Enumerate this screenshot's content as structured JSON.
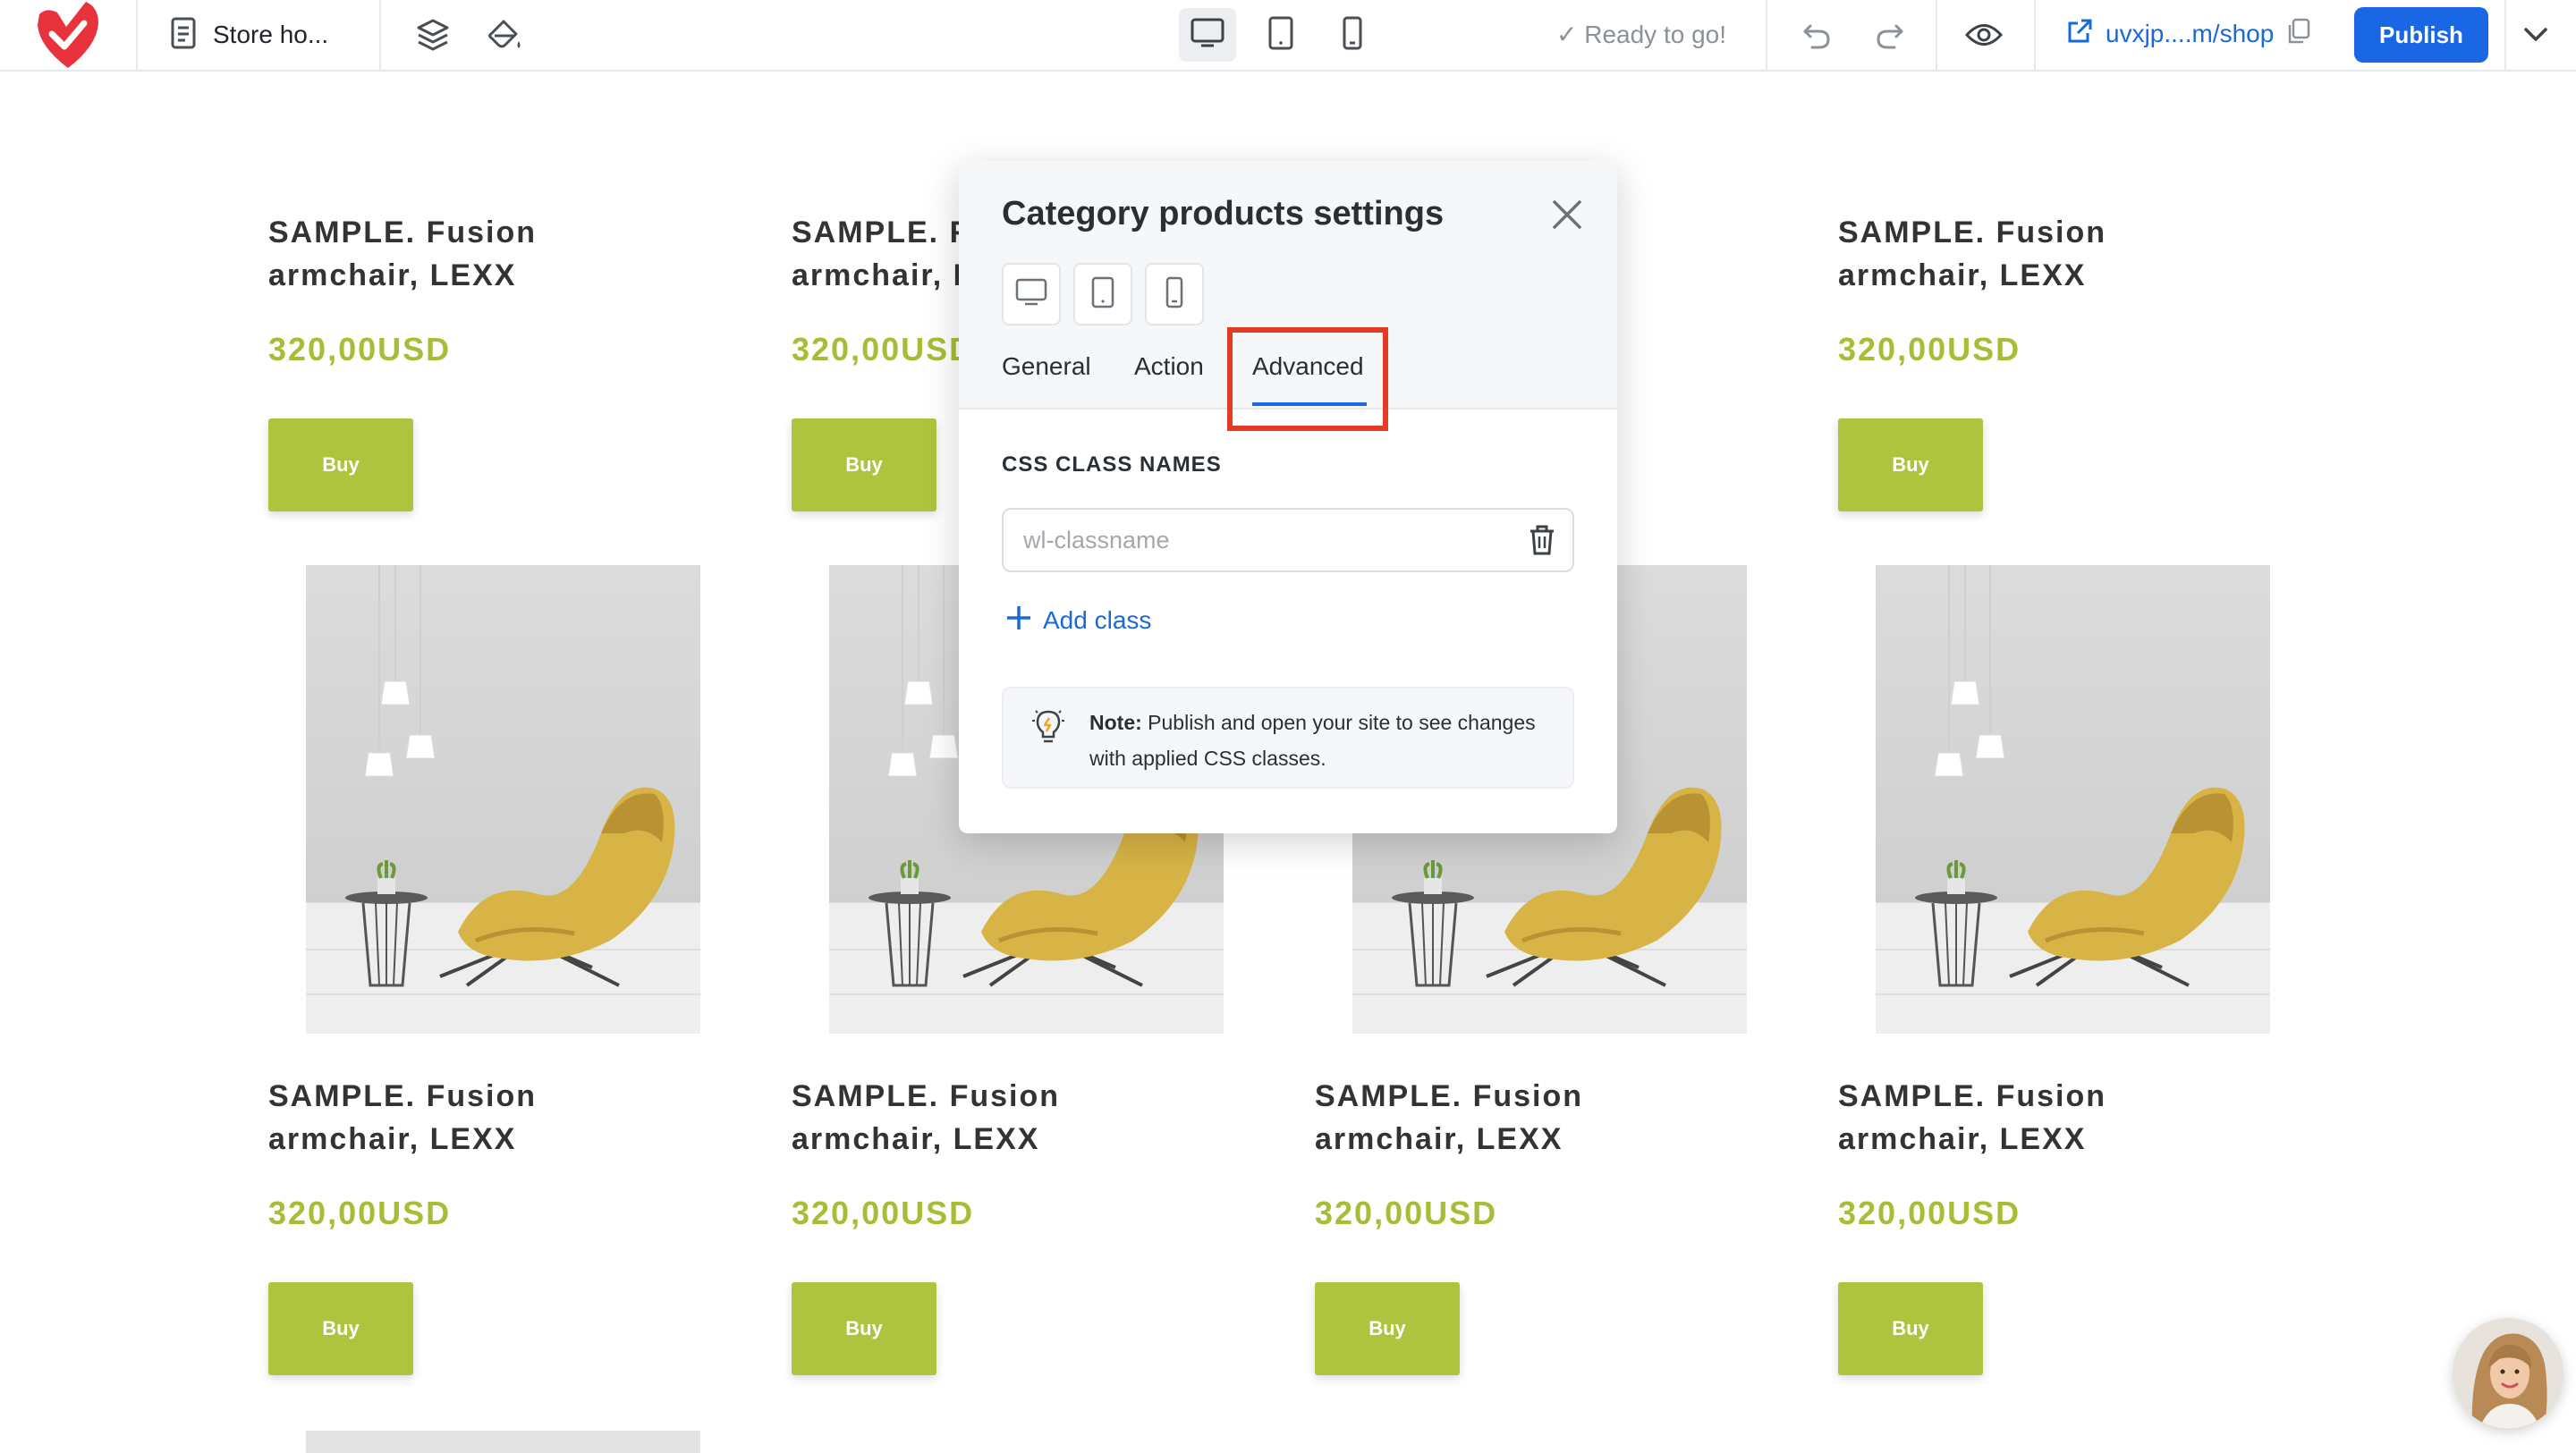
{
  "topbar": {
    "page_name": "Store ho...",
    "status": "✓ Ready to go!",
    "site_url": "uvxjp....m/shop",
    "publish_label": "Publish"
  },
  "products": [
    {
      "name": "SAMPLE. Fusion armchair, LEXX",
      "price": "320,00USD",
      "buy_label": "Buy"
    },
    {
      "name": "SAMPLE. Fusion armchair, LEXX",
      "price": "320,00USD",
      "buy_label": "Buy"
    },
    {
      "name": "SAMPLE. Fusion armchair, LEXX",
      "price": "320,00USD",
      "buy_label": "Buy"
    },
    {
      "name": "SAMPLE. Fusion armchair, LEXX",
      "price": "320,00USD",
      "buy_label": "Buy"
    },
    {
      "name": "SAMPLE. Fusion armchair, LEXX",
      "price": "320,00USD",
      "buy_label": "Buy"
    },
    {
      "name": "SAMPLE. Fusion armchair, LEXX",
      "price": "320,00USD",
      "buy_label": "Buy"
    },
    {
      "name": "SAMPLE. Fusion armchair, LEXX",
      "price": "320,00USD",
      "buy_label": "Buy"
    },
    {
      "name": "SAMPLE. Fusion armchair, LEXX",
      "price": "320,00USD",
      "buy_label": "Buy"
    }
  ],
  "panel": {
    "title": "Category products settings",
    "tabs": [
      "General",
      "Action",
      "Advanced"
    ],
    "active_tab": "Advanced",
    "section_title": "CSS CLASS NAMES",
    "class_placeholder": "wl-classname",
    "add_class_label": "Add class",
    "note_label": "Note:",
    "note_text": "Publish and open your site to see changes with applied CSS classes."
  },
  "colors": {
    "accent": "#1a67e6",
    "price": "#a6bd35",
    "buy_button": "#aec43e",
    "highlight": "#e43b23",
    "logo": "#e8323c"
  },
  "icons": [
    "logo-icon",
    "page-icon",
    "layers-icon",
    "paint-bucket-icon",
    "desktop-icon",
    "tablet-icon",
    "mobile-icon",
    "undo-icon",
    "redo-icon",
    "eye-icon",
    "external-link-icon",
    "copy-icon",
    "chevron-down-icon",
    "close-icon",
    "plus-icon",
    "trash-icon",
    "lightbulb-icon"
  ]
}
